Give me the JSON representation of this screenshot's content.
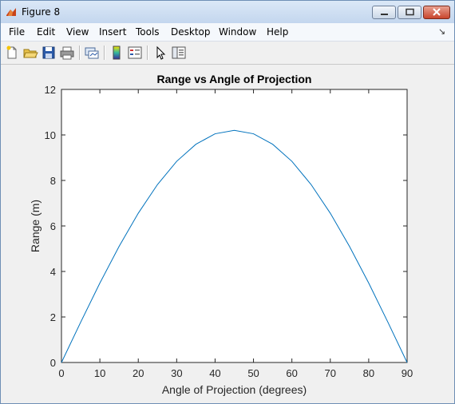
{
  "window": {
    "title": "Figure 8"
  },
  "menu": [
    {
      "id": "file",
      "label": "File"
    },
    {
      "id": "edit",
      "label": "Edit"
    },
    {
      "id": "view",
      "label": "View"
    },
    {
      "id": "insert",
      "label": "Insert"
    },
    {
      "id": "tools",
      "label": "Tools"
    },
    {
      "id": "desktop",
      "label": "Desktop"
    },
    {
      "id": "window",
      "label": "Window"
    },
    {
      "id": "help",
      "label": "Help"
    }
  ],
  "toolbar": [
    {
      "icon": "new-figure-icon"
    },
    {
      "icon": "open-folder-icon"
    },
    {
      "icon": "save-icon"
    },
    {
      "icon": "print-icon"
    },
    {
      "icon": "link-plot-icon"
    },
    {
      "icon": "colorbar-icon"
    },
    {
      "icon": "legend-icon"
    },
    {
      "icon": "edit-plot-pointer-icon"
    },
    {
      "icon": "property-inspector-icon"
    }
  ],
  "colors": {
    "line": "#0072bd",
    "axes_background": "#ffffff",
    "figure_background": "#f0f0f0"
  },
  "chart_data": {
    "type": "line",
    "title": "Range vs Angle of Projection",
    "xlabel": "Angle of Projection (degrees)",
    "ylabel": "Range (m)",
    "xlim": [
      0,
      90
    ],
    "ylim": [
      0,
      12
    ],
    "xticks": [
      0,
      10,
      20,
      30,
      40,
      50,
      60,
      70,
      80,
      90
    ],
    "yticks": [
      0,
      2,
      4,
      6,
      8,
      10,
      12
    ],
    "grid": false,
    "series": [
      {
        "x": [
          0,
          5,
          10,
          15,
          20,
          25,
          30,
          35,
          40,
          45,
          50,
          55,
          60,
          65,
          70,
          75,
          80,
          85,
          90
        ],
        "values": [
          0,
          1.77,
          3.49,
          5.1,
          6.56,
          7.82,
          8.84,
          9.59,
          10.05,
          10.2,
          10.05,
          9.59,
          8.84,
          7.82,
          6.56,
          5.1,
          3.49,
          1.77,
          0
        ]
      }
    ]
  }
}
